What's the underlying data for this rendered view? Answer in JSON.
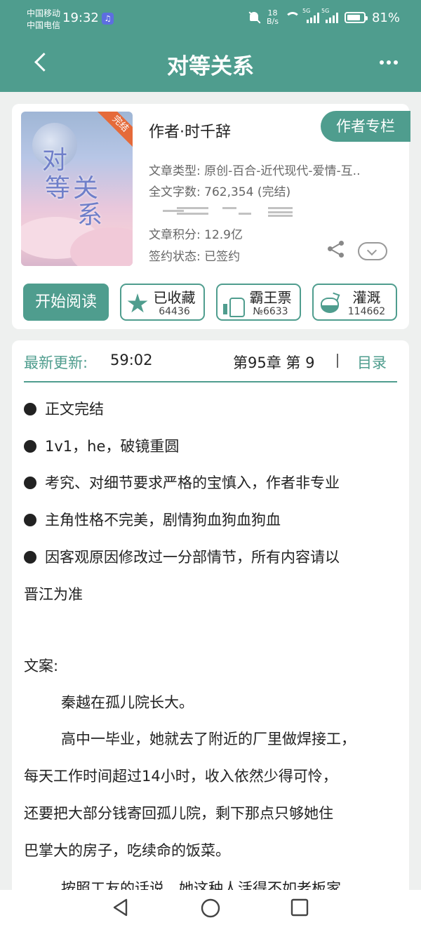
{
  "status": {
    "carrier1": "中国移动",
    "carrier2": "中国电信",
    "time": "19:32",
    "speed_value": "18",
    "speed_unit": "B/s",
    "battery": "81%"
  },
  "header": {
    "title": "对等关系"
  },
  "book": {
    "cover_title_chars": [
      "对",
      "等",
      "关",
      "系"
    ],
    "cover_badge": "完结",
    "author": "作者·时千辞",
    "author_tag": "作者专栏",
    "type": "文章类型: 原创-百合-近代现代-爱情-互..",
    "word_count": "全文字数: 762,354 (完结)",
    "score": "文章积分: 12.9亿",
    "sign_status": "签约状态: 已签约"
  },
  "actions": {
    "read": "开始阅读",
    "collect": {
      "label": "已收藏",
      "count": "64436"
    },
    "ticket": {
      "label": "霸王票",
      "count": "№6633"
    },
    "water": {
      "label": "灌溉",
      "count": "114662"
    }
  },
  "update": {
    "label": "最新更新:",
    "time": "59:02",
    "chapter": "第95章 第 9",
    "toc": "目录"
  },
  "tags": [
    "正文完结",
    "1v1，he，破镜重圆",
    "考究、对细节要求严格的宝慎入，作者非专业",
    "主角性格不完美，剧情狗血狗血狗血",
    "因客观原因修改过一分部情节，所有内容请以"
  ],
  "tags_cont": "晋江为准",
  "summary": {
    "label": "文案:",
    "p1": "秦越在孤儿院长大。",
    "p2_lines": [
      "高中一毕业，她就去了附近的厂里做焊接工，",
      "每天工作时间超过14小时，收入依然少得可怜，",
      "还要把大部分钱寄回孤儿院，剩下那点只够她住",
      "巴掌大的房子，吃续命的饭菜。"
    ],
    "p3": "按照工友的话说，她这种人活得不如老板家"
  }
}
